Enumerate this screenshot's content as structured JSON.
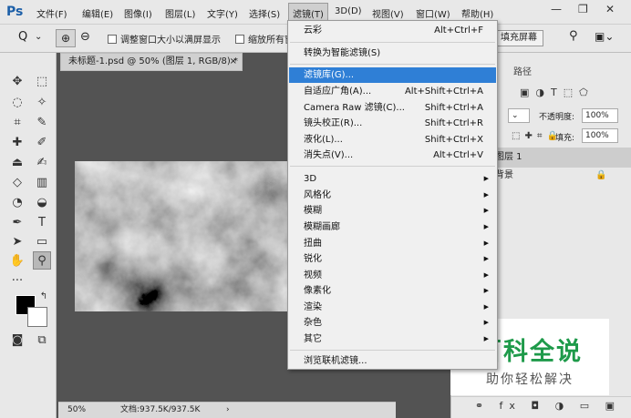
{
  "menubar": {
    "logo": "Ps",
    "items": [
      "文件(F)",
      "编辑(E)",
      "图像(I)",
      "图层(L)",
      "文字(Y)",
      "选择(S)",
      "滤镜(T)",
      "3D(D)",
      "视图(V)",
      "窗口(W)",
      "帮助(H)"
    ],
    "active_item": "滤镜(T)"
  },
  "options_bar": {
    "zoom_tool": "Q",
    "zoom_chevron": "⌄",
    "zoom_in": "⊕",
    "zoom_out": "⊖",
    "resize_windows_label": "调整窗口大小以满屏显示",
    "zoom_all_label": "缩放所有窗",
    "fill_screen_button": "填充屏幕",
    "search_icon": "search-icon",
    "workspace_icon": "workspace-icon"
  },
  "document": {
    "tab_title": "未标题-1.psd @ 50% (图层 1, RGB/8) *",
    "tab_close": "×",
    "zoom_level": "50%",
    "doc_info": "文档:937.5K/937.5K",
    "status_arrow": "›"
  },
  "filter_menu": {
    "items": [
      {
        "label": "云彩",
        "shortcut": "Alt+Ctrl+F",
        "submenu": false
      },
      {
        "label": "转换为智能滤镜(S)",
        "shortcut": "",
        "submenu": false
      },
      {
        "label": "滤镜库(G)...",
        "shortcut": "",
        "submenu": false,
        "highlighted": true
      },
      {
        "label": "自适应广角(A)...",
        "shortcut": "Alt+Shift+Ctrl+A",
        "submenu": false
      },
      {
        "label": "Camera Raw 滤镜(C)...",
        "shortcut": "Shift+Ctrl+A",
        "submenu": false
      },
      {
        "label": "镜头校正(R)...",
        "shortcut": "Shift+Ctrl+R",
        "submenu": false
      },
      {
        "label": "液化(L)...",
        "shortcut": "Shift+Ctrl+X",
        "submenu": false
      },
      {
        "label": "消失点(V)...",
        "shortcut": "Alt+Ctrl+V",
        "submenu": false
      },
      {
        "label": "3D",
        "shortcut": "",
        "submenu": true
      },
      {
        "label": "风格化",
        "shortcut": "",
        "submenu": true
      },
      {
        "label": "模糊",
        "shortcut": "",
        "submenu": true
      },
      {
        "label": "模糊画廊",
        "shortcut": "",
        "submenu": true
      },
      {
        "label": "扭曲",
        "shortcut": "",
        "submenu": true
      },
      {
        "label": "锐化",
        "shortcut": "",
        "submenu": true
      },
      {
        "label": "视频",
        "shortcut": "",
        "submenu": true
      },
      {
        "label": "像素化",
        "shortcut": "",
        "submenu": true
      },
      {
        "label": "渲染",
        "shortcut": "",
        "submenu": true
      },
      {
        "label": "杂色",
        "shortcut": "",
        "submenu": true
      },
      {
        "label": "其它",
        "shortcut": "",
        "submenu": true
      },
      {
        "label": "浏览联机滤镜...",
        "shortcut": "",
        "submenu": false
      }
    ],
    "submenu_arrow": "▶"
  },
  "layers_panel": {
    "tab_paths": "路径",
    "opacity_label": "不透明度:",
    "opacity_value": "100%",
    "fill_label": "填充:",
    "fill_value": "100%",
    "layers": [
      {
        "name": "图层 1",
        "selected": true
      },
      {
        "name": "背景",
        "selected": false,
        "locked": true
      }
    ],
    "bottom_icons": "⚭ fx ◘ ◑ ▭ ▣ 🗑"
  },
  "watermark": {
    "title": "百科全说",
    "subtitle": "助你轻松解决"
  },
  "colors": {
    "highlight": "#2f7fd6",
    "watermark_green": "#1e9a4a",
    "canvas_bg": "#535353"
  }
}
